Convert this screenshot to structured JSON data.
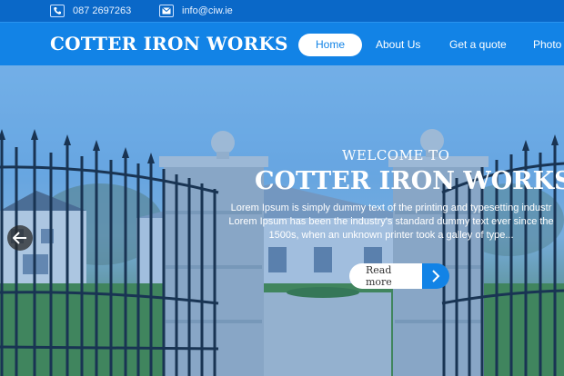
{
  "topbar": {
    "phone": "087 2697263",
    "email": "info@ciw.ie",
    "phone_icon": "phone-icon",
    "email_icon": "envelope-icon"
  },
  "header": {
    "logo": "COTTER IRON WORKS",
    "nav": [
      "Home",
      "About Us",
      "Get a quote",
      "Photo G"
    ]
  },
  "hero": {
    "welcome": "WELCOME TO",
    "title": "COTTER IRON WORKS",
    "text_lines": [
      "Lorem Ipsum is simply dummy text of the printing and typesetting industr",
      "Lorem Ipsum has been the industry's standard dummy text ever since the",
      "1500s, when an unknown printer took a galley of type..."
    ],
    "button_label": "Read more",
    "prev_icon": "arrow-left-icon",
    "next_icon": "chevron-right-icon"
  },
  "colors": {
    "primary": "#1283e6",
    "topbar": "#0a68c8"
  }
}
